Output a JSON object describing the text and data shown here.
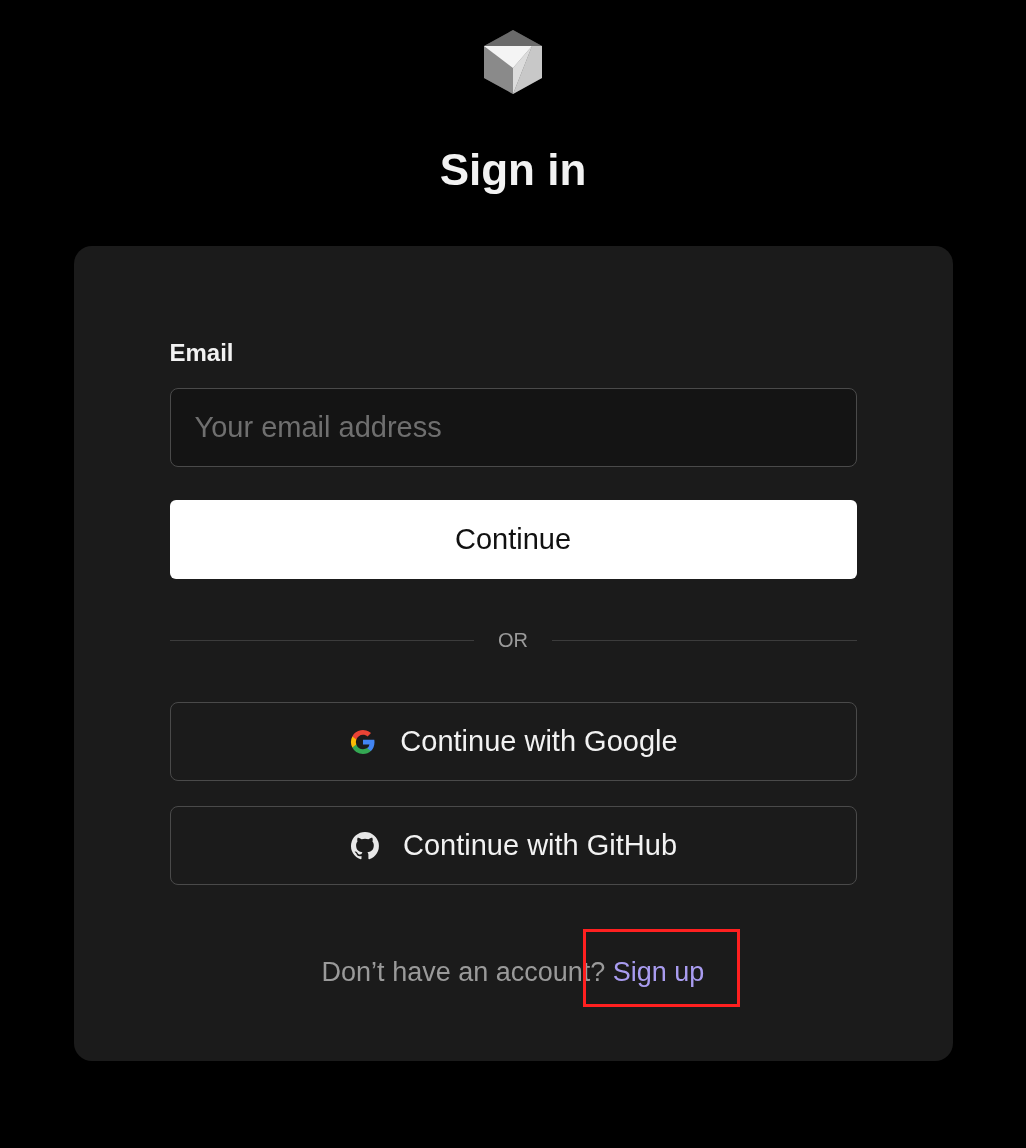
{
  "title": "Sign in",
  "form": {
    "email_label": "Email",
    "email_placeholder": "Your email address",
    "submit": "Continue",
    "divider": "OR"
  },
  "social_buttons": [
    {
      "kind": "google",
      "label": "Continue with Google"
    },
    {
      "kind": "github",
      "label": "Continue with GitHub"
    }
  ],
  "signup": {
    "prompt": "Don’t have an account?",
    "link": "Sign up",
    "highlighted": true
  }
}
